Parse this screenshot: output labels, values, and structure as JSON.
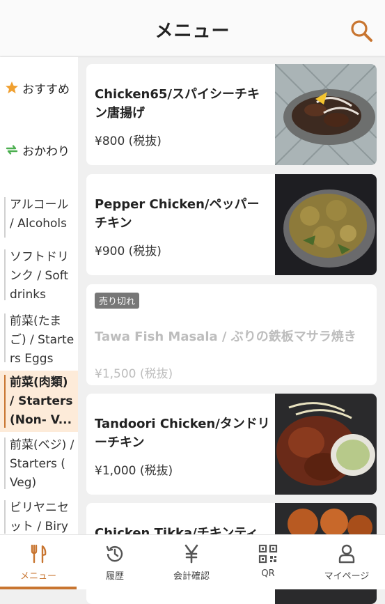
{
  "header": {
    "title": "メニュー",
    "search_icon": "search-icon"
  },
  "sidebar": {
    "fixed": [
      {
        "label": "おすすめ",
        "icon": "star-icon"
      },
      {
        "label": "おかわり",
        "icon": "refresh-icon"
      }
    ],
    "categories": [
      {
        "label": "アルコール / Alcohols"
      },
      {
        "label": "ソフトドリンク / Soft drinks"
      },
      {
        "label": "前菜(たまご) / Starters Eggs"
      },
      {
        "label": "前菜(肉類) / Starters (Non- V..."
      },
      {
        "label": "前菜(ベジ) / Starters ( Veg)"
      },
      {
        "label": "ビリヤニセット / Biry"
      }
    ]
  },
  "menu_items": [
    {
      "name": "Chicken65/スパイシーチキン唐揚げ",
      "price": "¥800 (税抜)"
    },
    {
      "name": "Pepper Chicken/ペッパーチキン",
      "price": "¥900 (税抜)"
    },
    {
      "name": "Tawa Fish Masala / ぶりの鉄板マサラ焼き",
      "price": "¥1,500 (税抜)",
      "badge": "売り切れ"
    },
    {
      "name": "Tandoori Chicken/タンドリーチキン",
      "price": "¥1,000 (税抜)"
    },
    {
      "name": "Chicken Tikka/チキンティ"
    }
  ],
  "tabbar": [
    {
      "label": "メニュー",
      "icon": "fork-knife-icon"
    },
    {
      "label": "履歴",
      "icon": "history-icon"
    },
    {
      "label": "会計確認",
      "icon": "yen-icon"
    },
    {
      "label": "QR",
      "icon": "qr-icon"
    },
    {
      "label": "マイページ",
      "icon": "user-icon"
    }
  ],
  "colors": {
    "accent": "#c87530",
    "active_category_bg": "#fdebd9",
    "soldout_text": "#bdbdbd"
  }
}
